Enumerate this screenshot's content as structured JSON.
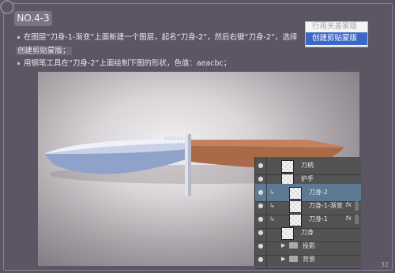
{
  "section_tag": "NO.4-3",
  "instructions": [
    {
      "text_a": "在图层“刀身-1-渐变”上面新建一个图层，起名“刀身-2”，然后右键“刀身-2”，选择",
      "text_b": "创建剪贴蒙版；"
    },
    {
      "text": "用钢笔工具在“刀身-2”上面绘制下图的形状，色值：aeacbc；"
    }
  ],
  "context_menu": {
    "item_above": "行用关盖家版",
    "selected": "创建剪贴蒙版"
  },
  "knife_colors": {
    "blade": "#c9d1e6",
    "handle": "#a96a47",
    "guard": "#e1e2ea",
    "fill_hex": "aeacbc"
  },
  "layers": [
    {
      "name": "刀柄",
      "clip": false,
      "fx": false,
      "type": "layer",
      "selected": false
    },
    {
      "name": "护手",
      "clip": false,
      "fx": false,
      "type": "layer",
      "selected": false
    },
    {
      "name": "刀身-2",
      "clip": true,
      "fx": false,
      "type": "layer",
      "selected": true
    },
    {
      "name": "刀身-1-渐变",
      "clip": true,
      "fx": true,
      "type": "layer",
      "selected": false
    },
    {
      "name": "刀身-1",
      "clip": true,
      "fx": true,
      "type": "layer",
      "selected": false
    },
    {
      "name": "刀身",
      "clip": false,
      "fx": false,
      "type": "layer",
      "selected": false
    },
    {
      "name": "投影",
      "clip": false,
      "fx": false,
      "type": "group",
      "selected": false
    },
    {
      "name": "背景",
      "clip": false,
      "fx": false,
      "type": "group",
      "selected": false
    }
  ],
  "icons": {
    "eye": "eye-icon",
    "clip": "clipping-arrow-icon",
    "fx": "fx",
    "folder": "folder-icon"
  },
  "page_number": "32"
}
